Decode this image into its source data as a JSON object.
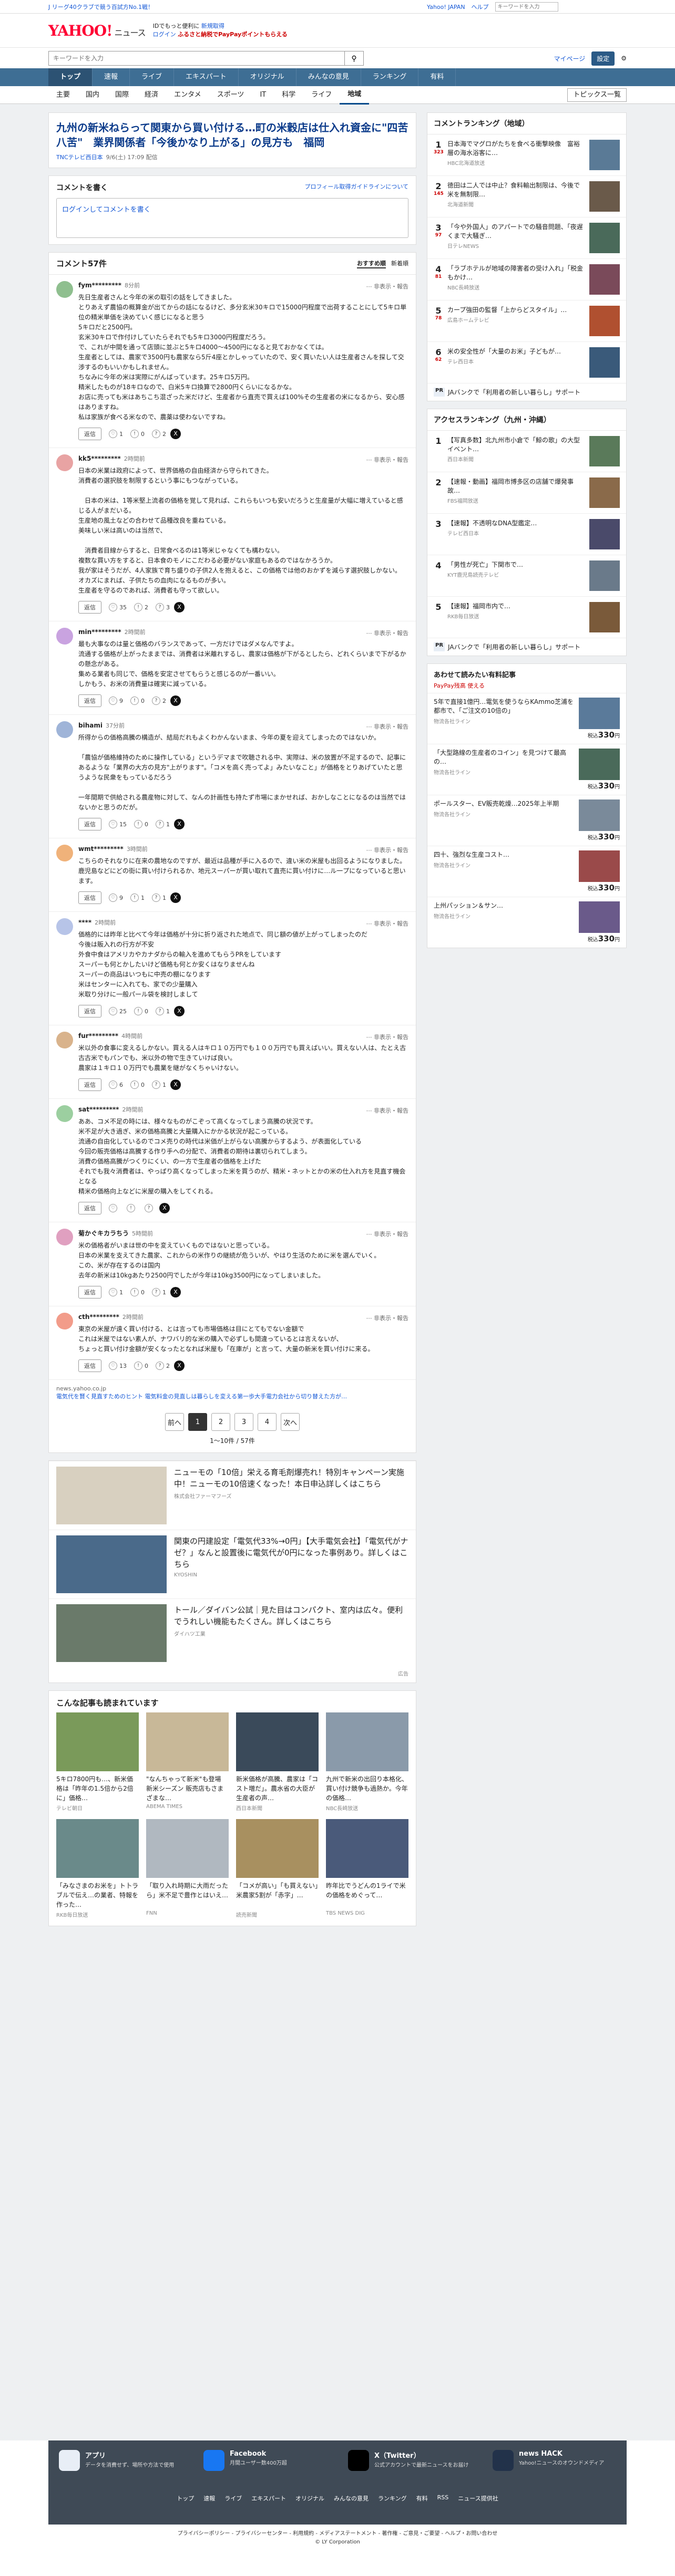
{
  "top": {
    "promo": "J リーグ40クラブで競う百試方No.1戦！",
    "links": [
      "Yahoo! JAPAN",
      "ヘルプ"
    ],
    "search_placeholder": "キーワードを入力",
    "search_btn": "ニュース内検索"
  },
  "header": {
    "logo": "YAHOO!",
    "logo_sub": "ニュース",
    "line1": "IDでもっと便利に",
    "line1b": "新規取得",
    "line2": "ログイン",
    "line2b": "ふるさと納税でPayPayポイントもらえる"
  },
  "search": {
    "placeholder": "キーワードを入力",
    "mypage": "マイページ",
    "settings": "設定"
  },
  "gnav": [
    "トップ",
    "速報",
    "ライブ",
    "エキスパート",
    "オリジナル",
    "みんなの意見",
    "ランキング",
    "有料"
  ],
  "subnav": [
    "主要",
    "国内",
    "国際",
    "経済",
    "エンタメ",
    "スポーツ",
    "IT",
    "科学",
    "ライフ",
    "地域"
  ],
  "subnav_active": "地域",
  "subnav_right": "トピックス一覧",
  "article": {
    "title": "九州の新米ねらって関東から買い付ける…町の米穀店は仕入れ資金に\"四苦八苦\"　業界関係者「今後かなり上がる」の見方も　福岡",
    "source": "TNCテレビ西日本",
    "time": "9/6(土) 17:09",
    "tag": "配信"
  },
  "write": {
    "label": "コメントを書く",
    "guide": "プロフィール取得ガイドラインについて",
    "box": "ログインしてコメントを書く"
  },
  "comments_head": {
    "count": "コメント57件",
    "sort": [
      "おすすめ順",
      "新着順"
    ]
  },
  "comments": [
    {
      "user": "fym*********",
      "time": "8分前",
      "body": "先日生産者さんと今年の米の取引の話をしてきました。\nとりあえず農協の概算金が出てからの話になるけど、多分玄米30キロで15000円程度で出荷することにして5キロ単位の精米単価を決めていく感じになると思う\n5キロだと2500円。\n玄米30キロで作付けしていたらそれでも5キロ3000円程度だろう。\nで、これが中間を通って店頭に並ぶと5キロ4000〜4500円になると見ておかなくては。\n生産者としては、農家で3500円も農家なら5斤4座とかしゃっていたので、安く買いたい人は生産者さんを探して交渉するのもいいかもしれません。\nちなみに今年の米は実際にがんばっています。25キロ5万円。\n精米したものが18キロなので、白米5キロ換算で2800円くらいになるかな。\nお店に売っても米はあちこち混ざった米だけど、生産者から直売で買えば100%その生産者の米になるから、安心感はありますね。\n私は家族が食べる米なので、農薬は使わないですね。",
      "votes": [
        "1",
        "0",
        "2"
      ]
    },
    {
      "user": "kk5*********",
      "time": "2時間前",
      "body": "日本の米業は政府によって、世界価格の自由経済から守られてきた。\n消費者の選択肢を制限するという事にもつながっている。\n\n　日本の米は、1等米堅上流者の価格を覚して見れば、これらもいつも安いだろうと生産量が大幅に増えていると感じる人がまだいる。\n生産地の風土などの合わせて品種改良を重ねている。\n美味しい米は高いのは当然で、\n\n　消費者目線からすると、日常食べるのは1等米じゃなくても構わない。\n複数な買い方をすると、日本食のモノにこだわる必要がない家庭もあるのではなかろうか。\n我が家はそうだが、4人家族で育ち盛りの子供2人を抱えると、この価格では他のおかずを減らす選択肢しかない。\nオカズにまれば、子供たちの血肉になるものが多い。\n生産者を守るのであれば、消費者も守って欲しい。",
      "votes": [
        "35",
        "2",
        "3"
      ]
    },
    {
      "user": "min*********",
      "time": "2時間前",
      "body": "最も大事なのは量と価格のバランスであって、一方だけではダメなんですよ。\n流通する価格が上がったままでは、消費者は米離れするし、農家は価格が下がるとしたら、どれくらいまで下がるかの懸念がある。\n集める業者も同じで、価格を安定させてもらうと感じるのが一番いい。\nしかもう、お米の消費量は確実に減っている。",
      "votes": [
        "9",
        "0",
        "2"
      ]
    },
    {
      "user": "bihami",
      "time": "37分前",
      "body": "所得からの価格高騰の構造が、結局だれもよくわかんないまま、今年の夏を迎えてしまったのではないか。\n\n「農協が価格維持のために操作している」というデマまで吹聴される中、実際は、米の放置が不足するので、記事にあるような「業界の大方の見方\"上がります\"。「コメを高く売ってよ」みたいなこと」が価格をとりあげていたと思うような民衆をもっているだろう\n\n一年間期で供給される農産物に対して、なんの計画性も持たず市場にまかせれば、おかしなことになるのは当然ではないかと思うのだが。",
      "votes": [
        "15",
        "0",
        "1"
      ]
    },
    {
      "user": "wmt*********",
      "time": "3時間前",
      "body": "こちらのそれなりに在来の農地なのですが、最近は品種が手に入るので、違い米の米屋も出回るようになりました。\n鹿児島などにどの街に買い付けられるか、地元スーパーが買い取れて直売に買い付けに…ル一プになっていると思います。",
      "votes": [
        "9",
        "1",
        "1"
      ]
    },
    {
      "user": "****",
      "time": "2時間前",
      "body": "価格的には昨年と比べて今年は価格が十分に折り返された地点で、同じ額の値が上がってしまったのだ\n今後は販入れの行方が不安\n外食中食はアメリカやカナダからの輸入を進めてもらうPRをしています\nスーパーも何とかしたいけど価格も何とか安くはなりませんね\nスーパーの商品はいつもに中売の棚になります\n米はセンターに入れても、家での少量購入\n米取り分けに一般パール袋を検討しまして",
      "votes": [
        "25",
        "0",
        "1"
      ]
    },
    {
      "user": "fur*********",
      "time": "4時間前",
      "body": "米以外の食事に変えるしかない。買える人はキロ１０万円でも１００万円でも買えばいい。買えない人は、たとえ古古古米でもパンでも、米以外の物で生きていけば良い。\n農家は１キロ１０万円でも農業を継がなくちゃいけない。",
      "votes": [
        "6",
        "0",
        "1"
      ]
    },
    {
      "user": "sat*********",
      "time": "2時間前",
      "body": "ああ、コメ不足の時には、様々なものがこぞって高くなってしまう高騰の状況です。\n米不足が大き過ぎ、米の価格高騰と大量購入にかかる状況が起こっている。\n流通の自由化しているのでコメ売りの時代は米価が上がらない高騰からするよう、が表面化している\n今回の販売価格は高騰する作り手への分配で、消費者の期待は裏切られてしまう。\n消費の価格高騰がつくりにくい、の一方で生産者の価格を上げた\nそれでも我々消費者は、やっぱり高くなってしまった米を買うのが、精米・ネットとかの米の仕入れ方を見直す機会となる\n精米の価格向上などに米屋の購入をしてくれる。",
      "votes": [
        "",
        "",
        ""
      ]
    },
    {
      "user": "菊かぐキカラちう",
      "time": "5時間前",
      "body": "米の価格者がいまは世の中を変えていくものではないと思っている。\n日本の米業を支えてきた農家、これからの米作りの継続が危ういが、やはり生活のために米を選んでいく。\nこの、米が存在するのは国内\n去年の新米は10kgあたり2500円でしたが今年は10kg3500円になってしまいました。",
      "votes": [
        "1",
        "0",
        "1"
      ]
    },
    {
      "user": "cth*********",
      "time": "2時間前",
      "body": "東京の米屋が遠く買い付ける、とは言っても市場価格は目にとてもでない金額で\nこれは米屋ではない素人が、ナワバリ的な米の購入で必ずしも間違っているとは言えないが、\nちょっと買い付け金額が安くなったとなれば米屋も「在庫が」と言って、大量の新米を買い付けに来る。",
      "votes": [
        "13",
        "0",
        "2"
      ]
    }
  ],
  "more_note": "news.yahoo.co.jp",
  "more_links": "電気代を賢く見直すためのヒント 電気料金の見直しは暮らしを変える第一歩大手電力会社から切り替えた方が…",
  "pager": {
    "pages": [
      "前へ",
      "1",
      "2",
      "3",
      "4",
      "次へ"
    ],
    "current": "1",
    "info": "1〜10件 / 57件"
  },
  "ads": [
    {
      "title": "ニューモの「10倍」栄える育毛剤爆売れ！特別キャンペーン実施中！ニューモの10倍速くなった！本日申込詳しくはこちら",
      "src": "株式会社ファーマフーズ"
    },
    {
      "title": "関東の円建設定「電気代33%→0円」【大手電気会社】「電気代がナゼ？」なんと設置後に電気代が0円になった事例あり。詳しくはこちら",
      "src": "KYOSHIN"
    },
    {
      "title": "トール／ダイバン公試｜見た目はコンパクト、室内は広々。便利でうれしい機能もたくさん。詳しくはこちら",
      "src": "ダイハツ工業"
    }
  ],
  "ad_label": "広告",
  "reco": {
    "title": "こんな記事も読まれています",
    "items": [
      {
        "t": "5キロ7800円も…、新米価格は「昨年の1.5倍から2倍に」価格…",
        "s": "テレビ朝日"
      },
      {
        "t": "\"なんちゃって新米\"も登場 新米シーズン 販売店もさまざまな…",
        "s": "ABEMA TIMES"
      },
      {
        "t": "新米価格が高騰、農家は「コスト増だ」。農水省の大臣が生産者の声…",
        "s": "西日本新聞"
      },
      {
        "t": "九州で新米の出回り本格化、買い付け競争も過熱か。今年の価格…",
        "s": "NBC長崎放送"
      },
      {
        "t": "「みなさまのお米を」ト卜ラブルで伝え…の業者、特報を作った…",
        "s": "RKB毎日放送"
      },
      {
        "t": "「取り入れ時期に大雨だったら」米不足で豊作とはいえ…",
        "s": "FNN"
      },
      {
        "t": "「コメが高い」「も買えない」米農家5割が「赤字」…",
        "s": "読売新聞"
      },
      {
        "t": "昨年比でうどんの1ライで米の価格をめぐって…",
        "s": "TBS NEWS DIG"
      }
    ]
  },
  "rank": {
    "title": "コメントランキング（地域）",
    "items": [
      {
        "n": "1",
        "c": "323",
        "t": "日本海でマグロがたちを食べる衝撃映像　富裕層の海水浴客に…",
        "s": "HBC北海道放送",
        "th": "#5a7a96"
      },
      {
        "n": "2",
        "c": "145",
        "t": "徳田は二人では中止？食料輸出制限は、今後で米を無制限…",
        "s": "北海道新聞",
        "th": "#6a5a4a"
      },
      {
        "n": "3",
        "c": "97",
        "t": "「今や外国人」のアパートでの騒音問題、「夜遅くまで大騒ぎ…",
        "s": "日テレNEWS",
        "th": "#4a6a5a"
      },
      {
        "n": "4",
        "c": "81",
        "t": "「ラブホテルが地域の障害者の受け入れ」「税金もかけ…",
        "s": "NBC長崎放送",
        "th": "#7a4a5a"
      },
      {
        "n": "5",
        "c": "78",
        "t": "カープ強田の監督「上からどスタイル」…",
        "s": "広島ホームテレビ",
        "th": "#b05030"
      },
      {
        "n": "6",
        "c": "62",
        "t": "米の安全性が「大量のお米」子どもが…",
        "s": "テレ西日本",
        "th": "#3a5a7a"
      }
    ],
    "pr": "JAバンクで「利用者の新しい暮らし」サポート",
    "pr_src": "JAバンク"
  },
  "access": {
    "title": "アクセスランキング（九州・沖縄）",
    "items": [
      {
        "n": "1",
        "t": "【写真多数】北九州市小倉で「鯨の歌」の大型イベント…",
        "s": "西日本新聞",
        "th": "#5a7a5a"
      },
      {
        "n": "2",
        "t": "【速報・動画】福岡市博多区の店舗で爆発事故…",
        "s": "FBS福岡放送",
        "th": "#8a6a4a"
      },
      {
        "n": "3",
        "t": "【速報】不透明なDNA型鑑定…",
        "s": "テレビ西日本",
        "th": "#4a4a6a"
      },
      {
        "n": "4",
        "t": "「男性が死亡」下関市で…",
        "s": "KYT鹿児島読売テレビ",
        "th": "#6a7a8a"
      },
      {
        "n": "5",
        "t": "【速報】福岡市内で…",
        "s": "RKB毎日放送",
        "th": "#7a5a3a"
      }
    ],
    "pr": "JAバンクで「利用者の新しい暮らし」サポート",
    "pr_src": "JAバンク"
  },
  "adbox": {
    "title": "あわせて読みたい有料記事",
    "sub": "PayPay残高 使える",
    "items": [
      {
        "t": "5年で直接1億円…電気を使うならKAmmo芝浦を都市で、「ご注文の10倍の」",
        "s": "物流各社ライン",
        "price": "330"
      },
      {
        "t": "「大型路線の生産者のコイン」を見つけて最高の…",
        "s": "物流各社ライン",
        "price": "330"
      },
      {
        "t": "ポールスター、EV販売乾燥…2025年上半期",
        "s": "物流各社ライン",
        "price": "330"
      },
      {
        "t": "四十、強烈な生産コスト…",
        "s": "物流各社ライン",
        "price": "330"
      },
      {
        "t": "上州パッション＆サン…",
        "s": "物流各社ライン",
        "price": "330"
      }
    ]
  },
  "footer": {
    "apps": [
      {
        "n": "アプリ",
        "d": "データを消費せず、場所や方法で使用"
      },
      {
        "n": "Facebook",
        "d": "月間ユーザー数400万超"
      },
      {
        "n": "X（Twitter）",
        "d": "公式アカウントで最新ニュースをお届け"
      },
      {
        "n": "news HACK",
        "d": "Yahoo!ニュースのオウンドメディア"
      }
    ],
    "links": [
      "トップ",
      "速報",
      "ライブ",
      "エキスパート",
      "オリジナル",
      "みんなの意見",
      "ランキング",
      "有料",
      "RSS",
      "ニュース提供社"
    ],
    "legal": "プライバシーポリシー - プライバシーセンター - 利用規約 - メディアステートメント - 著作権 - ご意見・ご要望 - ヘルプ・お問い合わせ",
    "copy": "© LY Corporation"
  }
}
